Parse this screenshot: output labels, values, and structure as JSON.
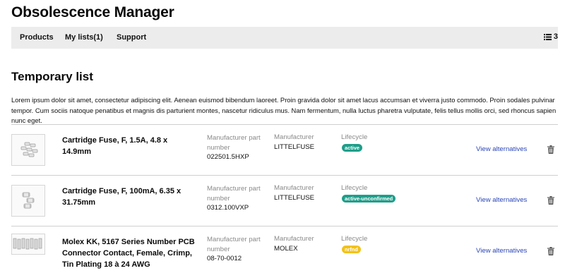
{
  "app": {
    "title": "Obsolescence Manager"
  },
  "nav": {
    "items": [
      {
        "label": "Products"
      },
      {
        "label": "My lists(1)"
      },
      {
        "label": "Support"
      }
    ],
    "list_count": "3",
    "list_icon": "list-icon"
  },
  "page": {
    "title": "Temporary list",
    "description": "Lorem ipsum dolor sit amet, consectetur adipiscing elit. Aenean euismod bibendum laoreet. Proin gravida dolor sit amet lacus accumsan et viverra justo commodo. Proin sodales pulvinar tempor. Cum sociis natoque penatibus et magnis dis parturient montes, nascetur ridiculus mus. Nam fermentum, nulla luctus pharetra vulputate, felis tellus mollis orci, sed rhoncus sapien nunc eget."
  },
  "parts": [
    {
      "name": "Cartridge Fuse, F, 1.5A, 4.8 x 14.9mm",
      "mpn_label": "Manufacturer part number",
      "mpn": "022501.5HXP",
      "manufacturer_label": "Manufacturer",
      "manufacturer": "LITTELFUSE",
      "lifecycle_label": "Lifecycle",
      "lifecycle": "active",
      "lifecycle_color": "#1f9e8a",
      "alternatives_label": "View alternatives",
      "delete_icon": "trash-icon"
    },
    {
      "name": "Cartridge Fuse, F, 100mA, 6.35 x 31.75mm",
      "mpn_label": "Manufacturer part number",
      "mpn": "0312.100VXP",
      "manufacturer_label": "Manufacturer",
      "manufacturer": "LITTELFUSE",
      "lifecycle_label": "Lifecycle",
      "lifecycle": "active-unconfirmed",
      "lifecycle_color": "#1f9e8a",
      "alternatives_label": "View alternatives",
      "delete_icon": "trash-icon"
    },
    {
      "name": "Molex KK, 5167 Series Number PCB Connector Contact, Female, Crimp, Tin Plating 18 à 24 AWG",
      "mpn_label": "Manufacturer part number",
      "mpn": "08-70-0012",
      "manufacturer_label": "Manufacturer",
      "manufacturer": "MOLEX",
      "lifecycle_label": "Lifecycle",
      "lifecycle": "nrfnd",
      "lifecycle_color": "#f2c21a",
      "alternatives_label": "View alternatives",
      "delete_icon": "trash-icon"
    }
  ]
}
